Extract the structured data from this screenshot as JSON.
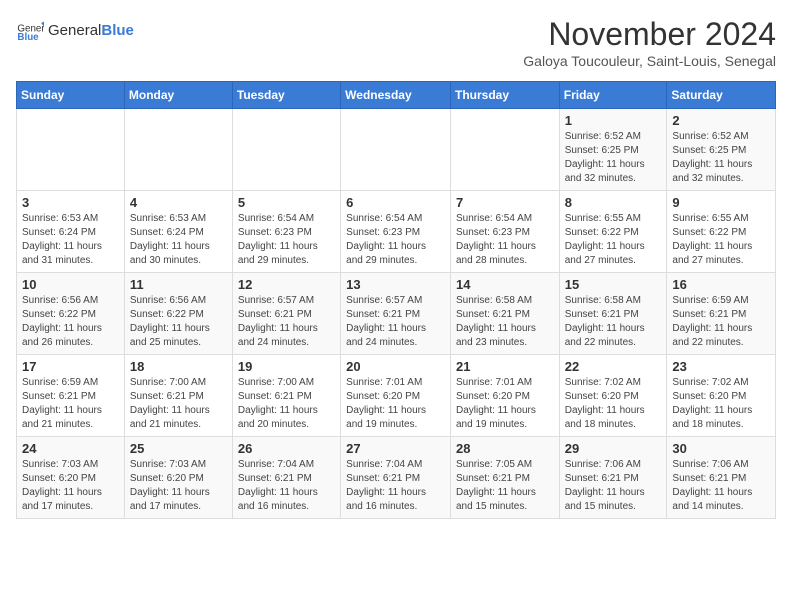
{
  "logo": {
    "general": "General",
    "blue": "Blue"
  },
  "title": "November 2024",
  "subtitle": "Galoya Toucouleur, Saint-Louis, Senegal",
  "days_of_week": [
    "Sunday",
    "Monday",
    "Tuesday",
    "Wednesday",
    "Thursday",
    "Friday",
    "Saturday"
  ],
  "weeks": [
    [
      {
        "day": "",
        "info": ""
      },
      {
        "day": "",
        "info": ""
      },
      {
        "day": "",
        "info": ""
      },
      {
        "day": "",
        "info": ""
      },
      {
        "day": "",
        "info": ""
      },
      {
        "day": "1",
        "info": "Sunrise: 6:52 AM\nSunset: 6:25 PM\nDaylight: 11 hours\nand 32 minutes."
      },
      {
        "day": "2",
        "info": "Sunrise: 6:52 AM\nSunset: 6:25 PM\nDaylight: 11 hours\nand 32 minutes."
      }
    ],
    [
      {
        "day": "3",
        "info": "Sunrise: 6:53 AM\nSunset: 6:24 PM\nDaylight: 11 hours\nand 31 minutes."
      },
      {
        "day": "4",
        "info": "Sunrise: 6:53 AM\nSunset: 6:24 PM\nDaylight: 11 hours\nand 30 minutes."
      },
      {
        "day": "5",
        "info": "Sunrise: 6:54 AM\nSunset: 6:23 PM\nDaylight: 11 hours\nand 29 minutes."
      },
      {
        "day": "6",
        "info": "Sunrise: 6:54 AM\nSunset: 6:23 PM\nDaylight: 11 hours\nand 29 minutes."
      },
      {
        "day": "7",
        "info": "Sunrise: 6:54 AM\nSunset: 6:23 PM\nDaylight: 11 hours\nand 28 minutes."
      },
      {
        "day": "8",
        "info": "Sunrise: 6:55 AM\nSunset: 6:22 PM\nDaylight: 11 hours\nand 27 minutes."
      },
      {
        "day": "9",
        "info": "Sunrise: 6:55 AM\nSunset: 6:22 PM\nDaylight: 11 hours\nand 27 minutes."
      }
    ],
    [
      {
        "day": "10",
        "info": "Sunrise: 6:56 AM\nSunset: 6:22 PM\nDaylight: 11 hours\nand 26 minutes."
      },
      {
        "day": "11",
        "info": "Sunrise: 6:56 AM\nSunset: 6:22 PM\nDaylight: 11 hours\nand 25 minutes."
      },
      {
        "day": "12",
        "info": "Sunrise: 6:57 AM\nSunset: 6:21 PM\nDaylight: 11 hours\nand 24 minutes."
      },
      {
        "day": "13",
        "info": "Sunrise: 6:57 AM\nSunset: 6:21 PM\nDaylight: 11 hours\nand 24 minutes."
      },
      {
        "day": "14",
        "info": "Sunrise: 6:58 AM\nSunset: 6:21 PM\nDaylight: 11 hours\nand 23 minutes."
      },
      {
        "day": "15",
        "info": "Sunrise: 6:58 AM\nSunset: 6:21 PM\nDaylight: 11 hours\nand 22 minutes."
      },
      {
        "day": "16",
        "info": "Sunrise: 6:59 AM\nSunset: 6:21 PM\nDaylight: 11 hours\nand 22 minutes."
      }
    ],
    [
      {
        "day": "17",
        "info": "Sunrise: 6:59 AM\nSunset: 6:21 PM\nDaylight: 11 hours\nand 21 minutes."
      },
      {
        "day": "18",
        "info": "Sunrise: 7:00 AM\nSunset: 6:21 PM\nDaylight: 11 hours\nand 21 minutes."
      },
      {
        "day": "19",
        "info": "Sunrise: 7:00 AM\nSunset: 6:21 PM\nDaylight: 11 hours\nand 20 minutes."
      },
      {
        "day": "20",
        "info": "Sunrise: 7:01 AM\nSunset: 6:20 PM\nDaylight: 11 hours\nand 19 minutes."
      },
      {
        "day": "21",
        "info": "Sunrise: 7:01 AM\nSunset: 6:20 PM\nDaylight: 11 hours\nand 19 minutes."
      },
      {
        "day": "22",
        "info": "Sunrise: 7:02 AM\nSunset: 6:20 PM\nDaylight: 11 hours\nand 18 minutes."
      },
      {
        "day": "23",
        "info": "Sunrise: 7:02 AM\nSunset: 6:20 PM\nDaylight: 11 hours\nand 18 minutes."
      }
    ],
    [
      {
        "day": "24",
        "info": "Sunrise: 7:03 AM\nSunset: 6:20 PM\nDaylight: 11 hours\nand 17 minutes."
      },
      {
        "day": "25",
        "info": "Sunrise: 7:03 AM\nSunset: 6:20 PM\nDaylight: 11 hours\nand 17 minutes."
      },
      {
        "day": "26",
        "info": "Sunrise: 7:04 AM\nSunset: 6:21 PM\nDaylight: 11 hours\nand 16 minutes."
      },
      {
        "day": "27",
        "info": "Sunrise: 7:04 AM\nSunset: 6:21 PM\nDaylight: 11 hours\nand 16 minutes."
      },
      {
        "day": "28",
        "info": "Sunrise: 7:05 AM\nSunset: 6:21 PM\nDaylight: 11 hours\nand 15 minutes."
      },
      {
        "day": "29",
        "info": "Sunrise: 7:06 AM\nSunset: 6:21 PM\nDaylight: 11 hours\nand 15 minutes."
      },
      {
        "day": "30",
        "info": "Sunrise: 7:06 AM\nSunset: 6:21 PM\nDaylight: 11 hours\nand 14 minutes."
      }
    ]
  ]
}
